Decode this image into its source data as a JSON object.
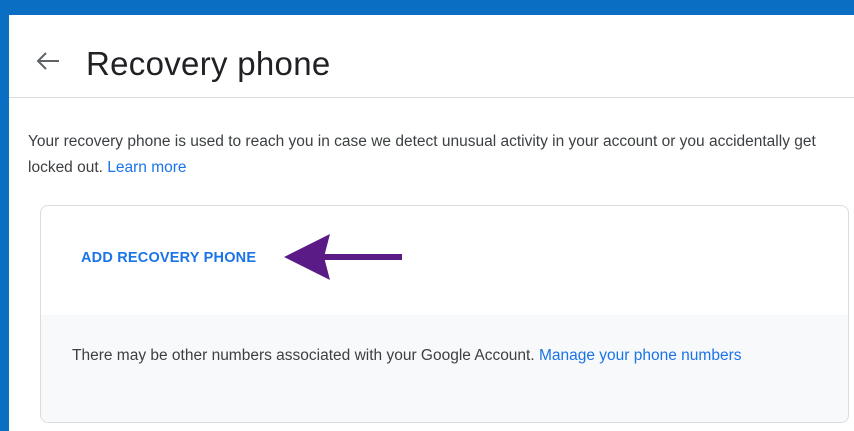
{
  "header": {
    "title": "Recovery phone",
    "back_icon": "arrow-back-icon"
  },
  "description": {
    "text": "Your recovery phone is used to reach you in case we detect unusual activity in your account or you accidentally get locked out.",
    "link": "Learn more"
  },
  "card": {
    "add_button_label": "ADD RECOVERY PHONE",
    "annotation_icon": "arrow-left-icon",
    "note_text": "There may be other numbers associated with your Google Account.",
    "note_link": "Manage your phone numbers"
  },
  "colors": {
    "frame_border": "#0a6fc2",
    "link": "#1a73e8",
    "annotation_arrow": "#5b1b86"
  }
}
